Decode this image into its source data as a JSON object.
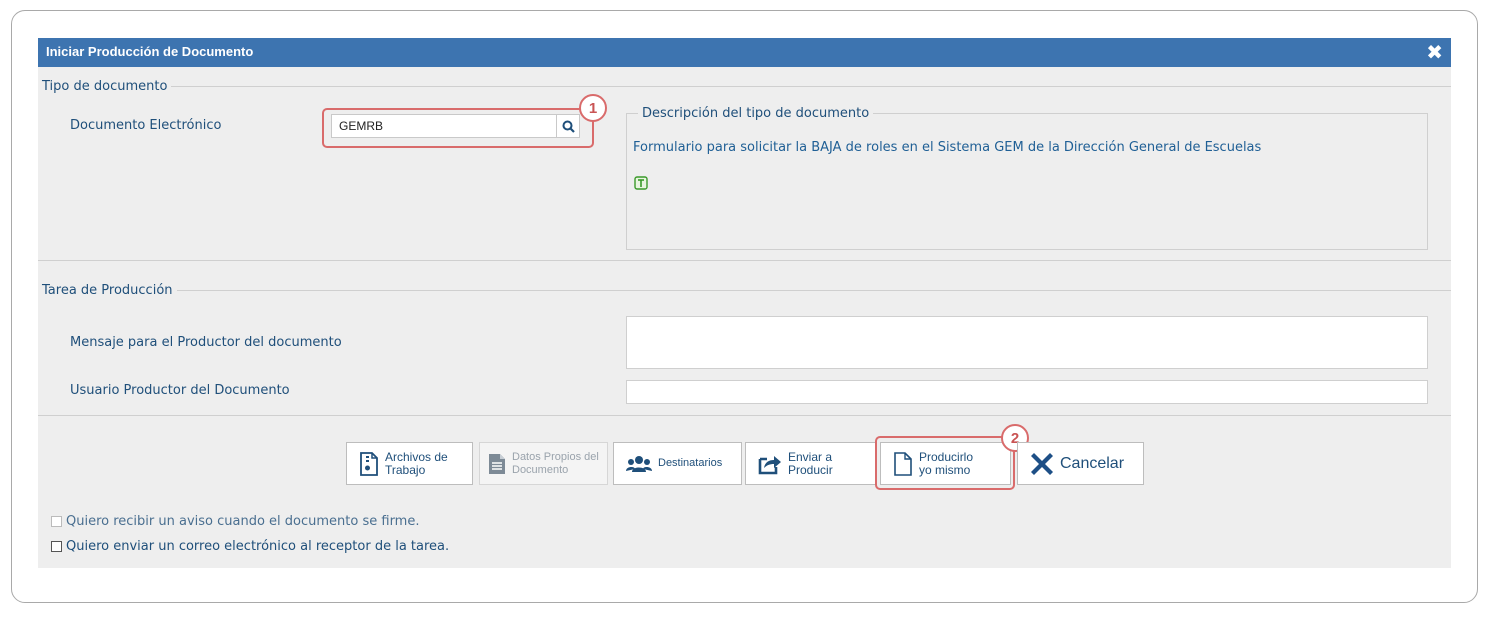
{
  "dialog": {
    "title": "Iniciar Producción de Documento",
    "close_symbol": "✖"
  },
  "tipo_documento": {
    "legend": "Tipo de documento",
    "field_label": "Documento Electrónico",
    "field_value": "GEMRB",
    "description_legend": "Descripción del tipo de documento",
    "description_text": "Formulario para solicitar la BAJA de roles en el Sistema GEM de la Dirección General de Escuelas",
    "icon": "template-icon"
  },
  "tarea_produccion": {
    "legend": "Tarea de Producción",
    "mensaje_label": "Mensaje para el Productor del documento",
    "mensaje_value": "",
    "usuario_label": "Usuario Productor del Documento",
    "usuario_value": ""
  },
  "actions": {
    "archivos": "Archivos de\nTrabajo",
    "datos": "Datos Propios del\nDocumento",
    "destinatarios": "Destinatarios",
    "enviar": "Enviar a\nProducir",
    "producirlo": "Producirlo\nyo mismo",
    "cancelar": "Cancelar"
  },
  "checkboxes": {
    "aviso": "Quiero recibir un aviso cuando el documento se firme.",
    "correo": "Quiero enviar un correo electrónico al receptor de la tarea."
  },
  "annotations": {
    "badge1": "1",
    "badge2": "2"
  },
  "colors": {
    "titlebar": "#3d74b0",
    "accent_text": "#1f4f7a",
    "highlight": "#d96b6b",
    "cancel_icon": "#1d4f86"
  }
}
